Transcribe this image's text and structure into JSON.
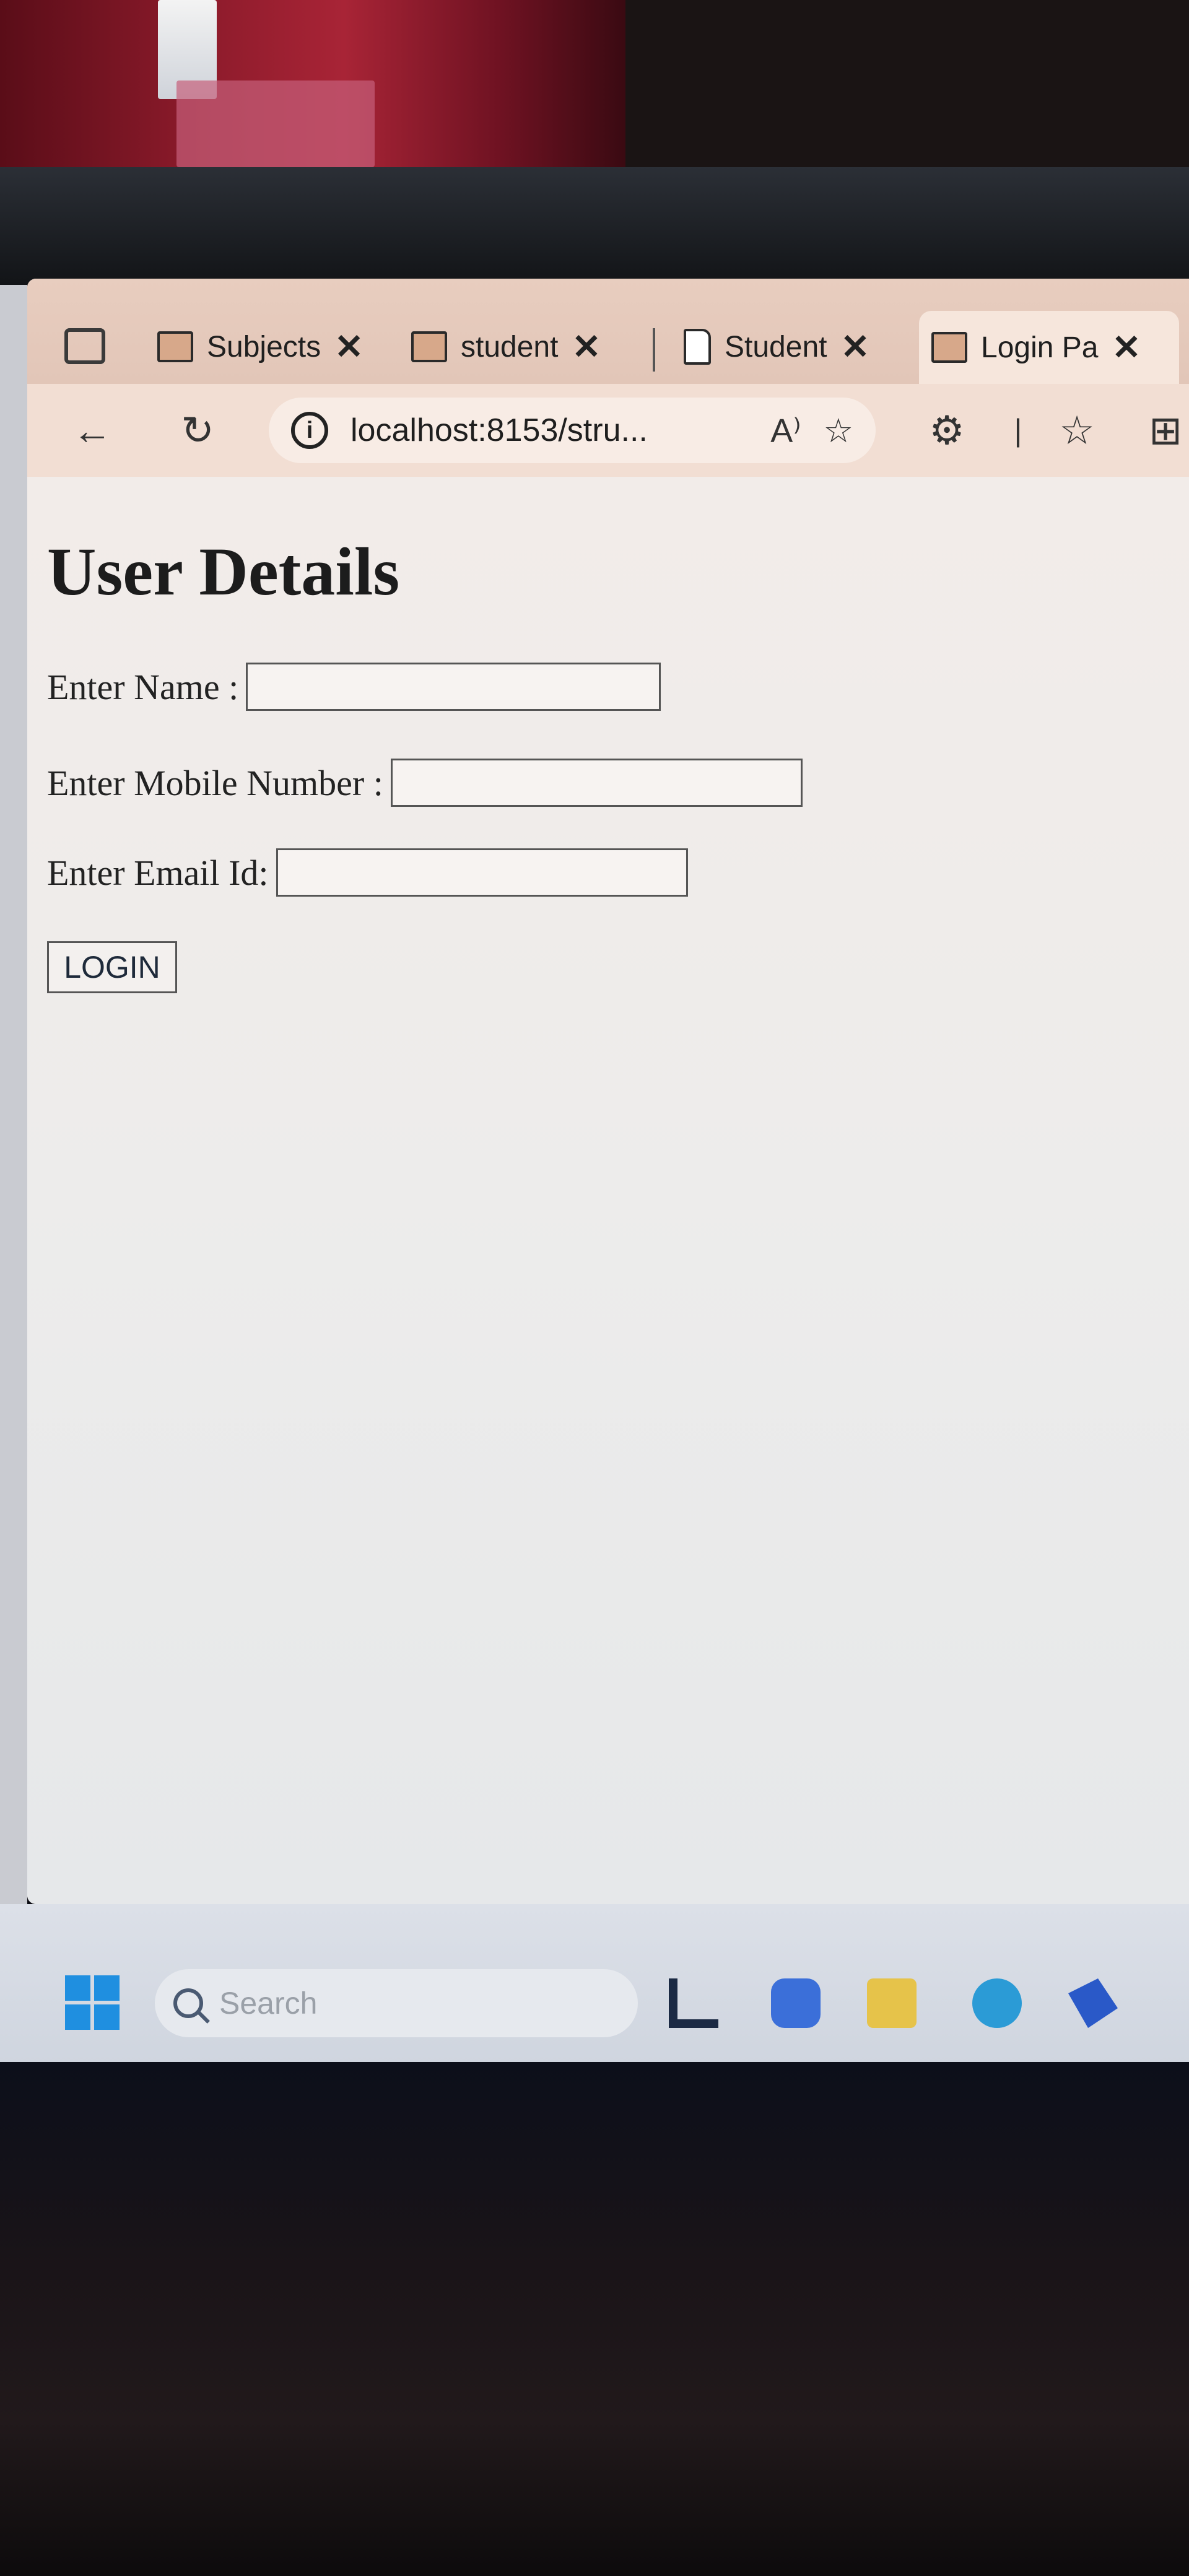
{
  "browser": {
    "tabs": [
      {
        "label": "Subjects",
        "icon": "image-icon",
        "active": false
      },
      {
        "label": "student",
        "icon": "image-icon",
        "active": false
      },
      {
        "label": "Student",
        "icon": "document-icon",
        "active": false
      },
      {
        "label": "Login Pa",
        "icon": "image-icon",
        "active": true
      }
    ],
    "address": "localhost:8153/stru...",
    "read_aloud_label": "A⁾"
  },
  "page": {
    "title": "User Details",
    "fields": [
      {
        "label": "Enter Name :",
        "value": ""
      },
      {
        "label": "Enter Mobile Number :",
        "value": ""
      },
      {
        "label": "Enter Email Id:",
        "value": ""
      }
    ],
    "login_label": "LOGIN"
  },
  "taskbar": {
    "search_placeholder": "Search"
  },
  "colors": {
    "tabstrip": "#e2c6b8",
    "toolbar": "#f2ded3",
    "windows_blue": "#1f8fe0"
  }
}
